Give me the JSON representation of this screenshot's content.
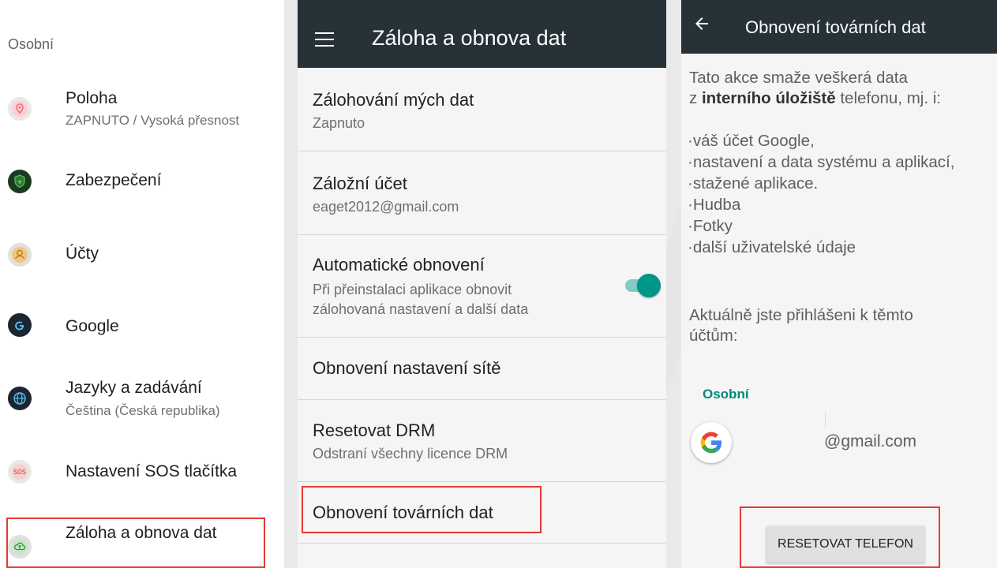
{
  "colors": {
    "accent_red": "#e53935",
    "teal": "#009688",
    "appbar": "#263238"
  },
  "panel1": {
    "section_title": "Osobní",
    "items": [
      {
        "title": "Poloha",
        "subtitle": "ZAPNUTO / Vysoká přesnost",
        "icon": "location-icon"
      },
      {
        "title": "Zabezpečení",
        "icon": "shield-icon"
      },
      {
        "title": "Účty",
        "icon": "account-icon"
      },
      {
        "title": "Google",
        "icon": "google-icon"
      },
      {
        "title": "Jazyky a zadávání",
        "subtitle": "Čeština (Česká republika)",
        "icon": "globe-icon"
      },
      {
        "title": "Nastavení SOS tlačítka",
        "icon": "sos-icon"
      },
      {
        "title": "Záloha a obnova dat",
        "icon": "cloud-backup-icon"
      }
    ]
  },
  "panel2": {
    "title": "Záloha a obnova dat",
    "rows": [
      {
        "title": "Zálohování mých dat",
        "subtitle": "Zapnuto"
      },
      {
        "title": "Záložní účet",
        "subtitle": "eaget2012@gmail.com"
      },
      {
        "title": "Automatické obnovení",
        "subtitle_line1": "Při přeinstalaci aplikace obnovit",
        "subtitle_line2": "zálohovaná nastavení a další data",
        "toggle_on": true
      },
      {
        "title": "Obnovení nastavení sítě"
      },
      {
        "title": "Resetovat DRM",
        "subtitle": "Odstraní všechny licence DRM"
      },
      {
        "title": "Obnovení továrních dat"
      }
    ]
  },
  "panel3": {
    "title": "Obnovení továrních dat",
    "intro_line1": "Tato akce smaže veškerá data",
    "intro_line2_pre": "z ",
    "intro_line2_bold": "interního úložiště",
    "intro_line2_post": " telefonu, mj. i:",
    "bullets": [
      "·váš účet Google,",
      "·nastavení a data systému a aplikací,",
      "·stažené aplikace.",
      "·Hudba",
      "·Fotky",
      "·další uživatelské údaje"
    ],
    "accounts_line1": "Aktuálně jste přihlášeni k těmto",
    "accounts_line2": "účtům:",
    "account_section": "Osobní",
    "account_email": "@gmail.com",
    "reset_button": "RESETOVAT TELEFON"
  }
}
